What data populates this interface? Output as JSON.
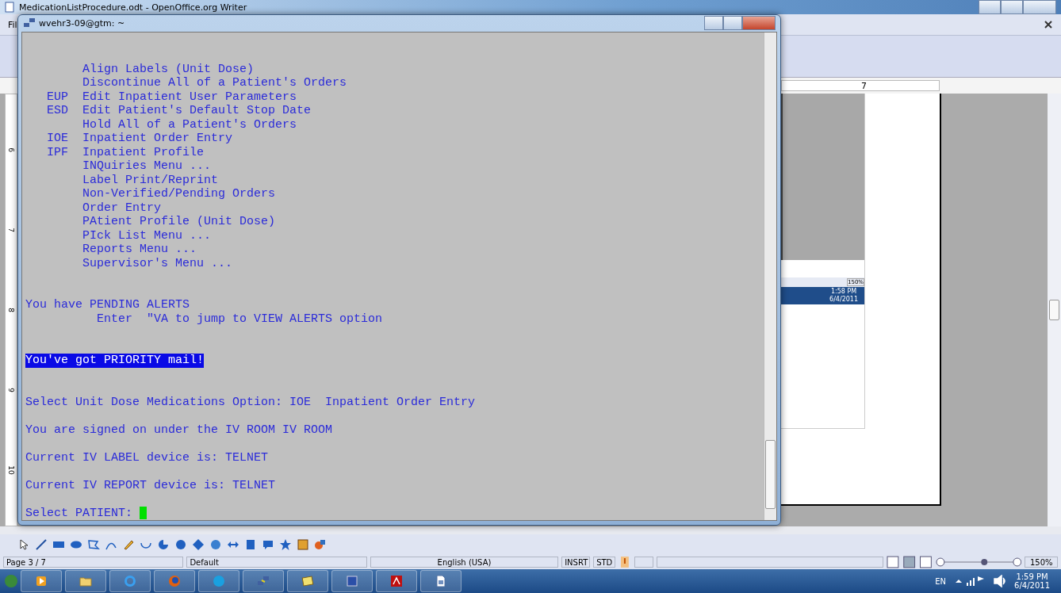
{
  "writer": {
    "title": "MedicationListProcedure.odt - OpenOffice.org Writer",
    "menu": [
      "Fil"
    ],
    "ruler_number": "7",
    "vertical_ruler": [
      "6",
      "7",
      "8",
      "9",
      "10"
    ],
    "embedded_image": {
      "zoom": "150%",
      "time": "1:58 PM",
      "date": "6/4/2011"
    },
    "status_bar": {
      "page": "Page 3 / 7",
      "style": "Default",
      "language": "English (USA)",
      "insert_mode": "INSRT",
      "selection_mode": "STD",
      "zoom": "150%"
    }
  },
  "terminal": {
    "title": "wvehr3-09@gtm: ~",
    "menu_options": [
      {
        "label": "Align Labels (Unit Dose)"
      },
      {
        "label": "Discontinue All of a Patient's Orders"
      },
      {
        "code": "EUP",
        "label": "Edit Inpatient User Parameters"
      },
      {
        "code": "ESD",
        "label": "Edit Patient's Default Stop Date"
      },
      {
        "label": "Hold All of a Patient's Orders"
      },
      {
        "code": "IOE",
        "label": "Inpatient Order Entry"
      },
      {
        "code": "IPF",
        "label": "Inpatient Profile"
      },
      {
        "label": "INQuiries Menu ..."
      },
      {
        "label": "Label Print/Reprint"
      },
      {
        "label": "Non-Verified/Pending Orders"
      },
      {
        "label": "Order Entry"
      },
      {
        "label": "PAtient Profile (Unit Dose)"
      },
      {
        "label": "PIck List Menu ..."
      },
      {
        "label": "Reports Menu ..."
      },
      {
        "label": "Supervisor's Menu ..."
      }
    ],
    "alert": "You have PENDING ALERTS",
    "alert_hint": "Enter  \"VA to jump to VIEW ALERTS option",
    "mail_notice": {
      "text": "You've got PRIORITY mail!",
      "highlighted": true
    },
    "prompts": [
      "Select Unit Dose Medications Option: IOE  Inpatient Order Entry",
      "You are signed on under the IV ROOM IV ROOM",
      "Current IV LABEL device is: TELNET",
      "Current IV REPORT device is: TELNET"
    ],
    "input_prompt": "Select PATIENT: "
  },
  "taskbar": {
    "language": "EN",
    "time": "1:59 PM",
    "date": "6/4/2011"
  }
}
